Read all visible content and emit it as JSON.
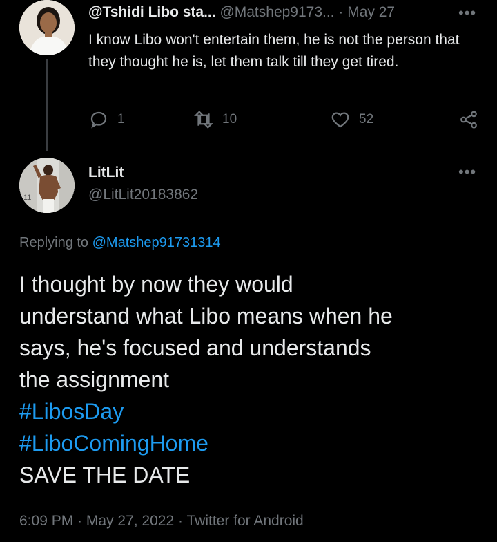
{
  "parent": {
    "display_name": "@Tshidi Libo sta...",
    "handle": "@Matshep9173...",
    "separator": "·",
    "date": "May 27",
    "text": "I know Libo won't entertain them, he is not the person that they thought he is, let them talk till they get tired.",
    "more_icon": "more-horizontal-icon",
    "actions": {
      "reply_count": "1",
      "retweet_count": "10",
      "like_count": "52"
    }
  },
  "reply": {
    "display_name": "LitLit",
    "handle": "@LitLit20183862",
    "replying_prefix": "Replying to",
    "replying_handle": "@Matshep91731314",
    "body_lines": [
      "I thought by now they would",
      "understand what Libo means when he",
      "says, he's focused and understands",
      "the assignment"
    ],
    "hashtags": [
      "#LibosDay",
      "#LiboComingHome"
    ],
    "closing": "SAVE THE DATE",
    "time": "6:09 PM",
    "date": "May 27, 2022",
    "separator": "·",
    "client": "Twitter for Android",
    "avatar_corner_text": "11"
  },
  "colors": {
    "background": "#000000",
    "text": "#e7e9ea",
    "muted": "#71767b",
    "link": "#1d9bf0"
  }
}
